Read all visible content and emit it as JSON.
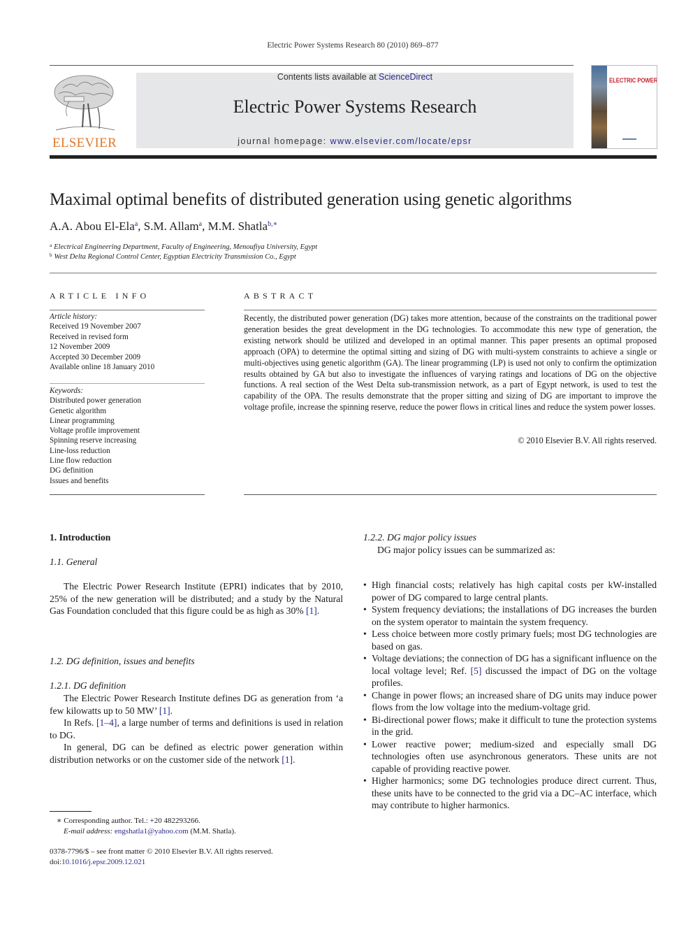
{
  "header": {
    "running_head": "Electric Power Systems Research 80 (2010) 869–877",
    "contents_prefix": "Contents lists available at ",
    "contents_link": "ScienceDirect",
    "journal_name": "Electric Power Systems Research",
    "homepage_prefix": "journal homepage: ",
    "homepage_link": "www.elsevier.com/locate/epsr",
    "publisher_logo_text": "ELSEVIER",
    "cover_title": "ELECTRIC POWER SYSTEMS RESEARCH",
    "accent_color": "#e0782a",
    "link_color": "#2a2a8a"
  },
  "article": {
    "title": "Maximal optimal benefits of distributed generation using genetic algorithms",
    "authors": [
      {
        "name": "A.A. Abou El-Ela",
        "sup": "a",
        "sep": ", "
      },
      {
        "name": "S.M. Allam",
        "sup": "a",
        "sep": ", "
      },
      {
        "name": "M.M. Shatla",
        "sup": "b,∗",
        "sep": ""
      }
    ],
    "affiliations": [
      {
        "mark": "a",
        "text": "Electrical Engineering Department, Faculty of Engineering, Menoufiya University, Egypt"
      },
      {
        "mark": "b",
        "text": "West Delta Regional Control Center, Egyptian Electricity Transmission Co., Egypt"
      }
    ]
  },
  "article_info": {
    "heading": "ARTICLE INFO",
    "history_label": "Article history:",
    "history": [
      "Received 19 November 2007",
      "Received in revised form",
      "12 November 2009",
      "Accepted 30 December 2009",
      "Available online 18 January 2010"
    ],
    "keywords_label": "Keywords:",
    "keywords": [
      "Distributed power generation",
      "Genetic algorithm",
      "Linear programming",
      "Voltage profile improvement",
      "Spinning reserve increasing",
      "Line-loss reduction",
      "Line flow reduction",
      "DG definition",
      "Issues and benefits"
    ]
  },
  "abstract": {
    "heading": "ABSTRACT",
    "text": "Recently, the distributed power generation (DG) takes more attention, because of the constraints on the traditional power generation besides the great development in the DG technologies. To accommodate this new type of generation, the existing network should be utilized and developed in an optimal manner. This paper presents an optimal proposed approach (OPA) to determine the optimal sitting and sizing of DG with multi-system constraints to achieve a single or multi-objectives using genetic algorithm (GA). The linear programming (LP) is used not only to confirm the optimization results obtained by GA but also to investigate the influences of varying ratings and locations of DG on the objective functions. A real section of the West Delta sub-transmission network, as a part of Egypt network, is used to test the capability of the OPA. The results demonstrate that the proper sitting and sizing of DG are important to improve the voltage profile, increase the spinning reserve, reduce the power flows in critical lines and reduce the system power losses.",
    "copyright": "© 2010 Elsevier B.V. All rights reserved."
  },
  "body": {
    "intro_heading": "1.  Introduction",
    "general_heading": "1.1.  General",
    "general_text": "The Electric Power Research Institute (EPRI) indicates that by 2010, 25% of the new generation will be distributed; and a study by the Natural Gas Foundation concluded that this figure could be as high as 30% ",
    "general_ref": "[1]",
    "dg_heading": "1.2.  DG definition, issues and benefits",
    "dgdef_heading": "1.2.1.  DG definition",
    "dgdef_p1_text": "The Electric Power Research Institute defines DG as generation from ‘a few kilowatts up to 50 MW’ ",
    "dgdef_p1_ref": "[1]",
    "dgdef_p2_pre": "In Refs. ",
    "dgdef_p2_ref": "[1–4]",
    "dgdef_p2_post": ", a large number of terms and definitions is used in relation to DG.",
    "dgdef_p3_text": "In general, DG can be defined as electric power generation within distribution networks or on the customer side of the network ",
    "dgdef_p3_ref": "[1]",
    "policy_heading": "1.2.2.  DG major policy issues",
    "policy_intro": "DG major policy issues can be summarized as:",
    "bullets": [
      {
        "pre": "High financial costs; relatively has high capital costs per kW-installed power of DG compared to large central plants.",
        "ref": "",
        "post": ""
      },
      {
        "pre": "System frequency deviations; the installations of DG increases the burden on the system operator to maintain the system frequency.",
        "ref": "",
        "post": ""
      },
      {
        "pre": "Less choice between more costly primary fuels; most DG technologies are based on gas.",
        "ref": "",
        "post": ""
      },
      {
        "pre": "Voltage deviations; the connection of DG has a significant influence on the local voltage level; Ref. ",
        "ref": "[5]",
        "post": " discussed the impact of DG on the voltage profiles."
      },
      {
        "pre": "Change in power flows; an increased share of DG units may induce power flows from the low voltage into the medium-voltage grid.",
        "ref": "",
        "post": ""
      },
      {
        "pre": "Bi-directional power flows; make it difficult to tune the protection systems in the grid.",
        "ref": "",
        "post": ""
      },
      {
        "pre": "Lower reactive power; medium-sized and especially small DG technologies often use asynchronous generators. These units are not capable of providing reactive power.",
        "ref": "",
        "post": ""
      },
      {
        "pre": "Higher harmonics; some DG technologies produce direct current. Thus, these units have to be connected to the grid via a DC–AC interface, which may contribute to higher harmonics.",
        "ref": "",
        "post": ""
      }
    ]
  },
  "footer": {
    "corresponding": "∗ Corresponding author. Tel.: +20 482293266.",
    "email_label": "E-mail address: ",
    "email": "engshatla1@yahoo.com",
    "email_suffix": " (M.M. Shatla).",
    "front_matter": "0378-7796/$ – see front matter © 2010 Elsevier B.V. All rights reserved.",
    "doi_label": "doi:",
    "doi": "10.1016/j.epsr.2009.12.021"
  }
}
